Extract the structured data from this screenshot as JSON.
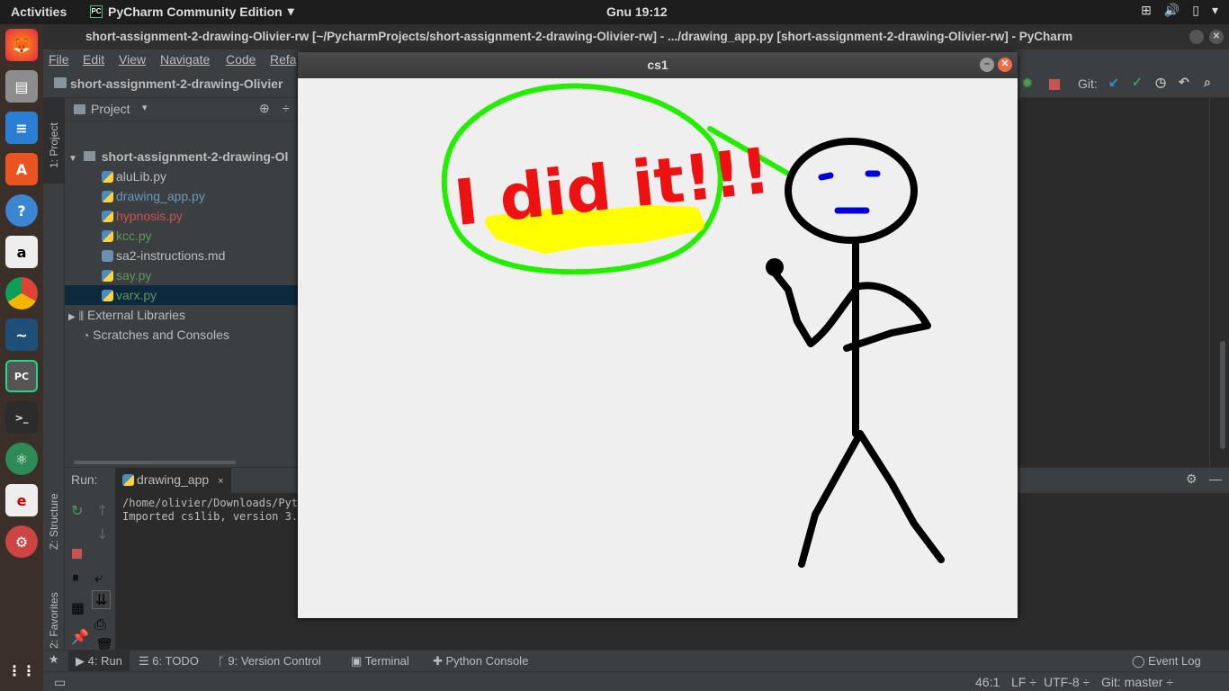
{
  "topbar": {
    "activities": "Activities",
    "app_name": "PyCharm Community Edition",
    "clock": "Gnu 19:12"
  },
  "window": {
    "title": "short-assignment-2-drawing-Olivier-rw [~/PycharmProjects/short-assignment-2-drawing-Olivier-rw] - .../drawing_app.py [short-assignment-2-drawing-Olivier-rw] - PyCharm"
  },
  "menu": {
    "file": "File",
    "edit": "Edit",
    "view": "View",
    "navigate": "Navigate",
    "code": "Code",
    "refactor": "Refa"
  },
  "navbar": {
    "project_name": "short-assignment-2-drawing-Olivier",
    "git_label": "Git:"
  },
  "sidebar_tabs": {
    "project": "1: Project",
    "structure": "Z: Structure",
    "favorites": "2: Favorites"
  },
  "project_panel": {
    "title": "Project",
    "root": "short-assignment-2-drawing-Ol",
    "files": [
      {
        "name": "aluLib.py",
        "color": "#bbbbbb"
      },
      {
        "name": "drawing_app.py",
        "color": "#6897bb"
      },
      {
        "name": "hypnosis.py",
        "color": "#c75450"
      },
      {
        "name": "kcc.py",
        "color": "#629755"
      },
      {
        "name": "sa2-instructions.md",
        "color": "#bbbbbb"
      },
      {
        "name": "say.py",
        "color": "#629755"
      },
      {
        "name": "varx.py",
        "color": "#629755"
      }
    ],
    "external": "External Libraries",
    "scratches": "Scratches and Consoles"
  },
  "run_panel": {
    "label": "Run:",
    "tab": "drawing_app",
    "lines": [
      "/home/olivier/Downloads/Pyt",
      "Imported cs1lib, version 3."
    ]
  },
  "bottom_tabs": {
    "run": "4: Run",
    "todo": "6: TODO",
    "vcs": "9: Version Control",
    "terminal": "Terminal",
    "python_console": "Python Console",
    "event_log": "Event Log"
  },
  "status": {
    "position": "46:1",
    "line_sep": "LF ÷",
    "encoding": "UTF-8 ÷",
    "git": "Git: master ÷"
  },
  "cs1_window": {
    "title": "cs1",
    "drawing_text": "I did it!!!",
    "colors": {
      "bubble": "#22ee00",
      "text": "#ee1111",
      "highlight": "#ffff00",
      "figure": "#000000",
      "face": "#0000dd",
      "canvas": "#efefef"
    }
  }
}
